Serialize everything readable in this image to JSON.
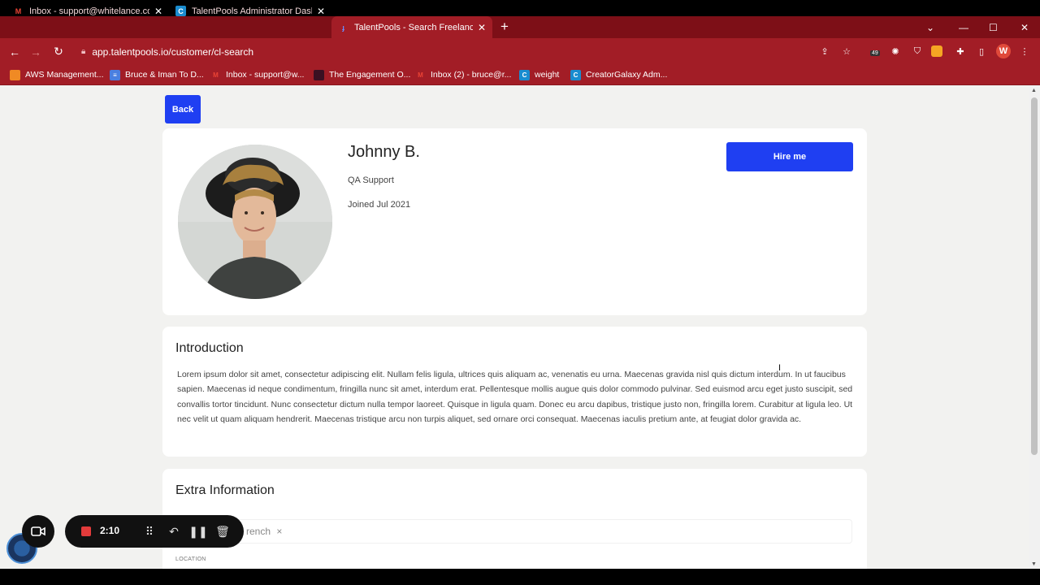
{
  "browser": {
    "tabs": [
      {
        "title": "Inbox - support@whitelance.co",
        "icon": "gmail-icon",
        "active": false
      },
      {
        "title": "TalentPools Administrator Dashb",
        "icon": "talentpools-c-icon",
        "active": false
      },
      {
        "title": "TalentPools - Search Freelancers",
        "icon": "talentpools-f-icon",
        "active": true
      }
    ],
    "url": "app.talentpools.io/customer/cl-search",
    "extension_badge": "49",
    "profile_initial": "W",
    "bookmarks": [
      {
        "label": "AWS Management...",
        "icon": "aws-icon"
      },
      {
        "label": "Bruce & Iman To D...",
        "icon": "docs-icon"
      },
      {
        "label": "Inbox - support@w...",
        "icon": "gmail-icon"
      },
      {
        "label": "The Engagement O...",
        "icon": "engagement-icon"
      },
      {
        "label": "Inbox (2) - bruce@r...",
        "icon": "gmail-icon"
      },
      {
        "label": "weight",
        "icon": "talentpools-c-icon"
      },
      {
        "label": "CreatorGalaxy Adm...",
        "icon": "talentpools-c-icon"
      }
    ]
  },
  "page": {
    "back_label": "Back",
    "profile": {
      "name": "Johnny B.",
      "role": "QA Support",
      "joined": "Joined Jul 2021",
      "hire_label": "Hire me"
    },
    "introduction": {
      "title": "Introduction",
      "text": "Lorem ipsum dolor sit amet, consectetur adipiscing elit. Nullam felis ligula, ultrices quis aliquam ac, venenatis eu urna. Maecenas gravida nisl quis dictum interdum. In ut faucibus sapien. Maecenas id neque condimentum, fringilla nunc sit amet, interdum erat. Pellentesque mollis augue quis dolor commodo pulvinar. Sed euismod arcu eget justo suscipit, sed convallis tortor tincidunt. Nunc consectetur dictum nulla tempor laoreet. Quisque in ligula quam. Donec eu arcu dapibus, tristique justo non, fringilla lorem. Curabitur at ligula leo. Ut nec velit ut quam aliquam hendrerit. Maecenas tristique arcu non turpis aliquet, sed ornare orci consequat. Maecenas iaculis pretium ante, at feugiat dolor gravida ac."
    },
    "extra": {
      "title": "Extra Information",
      "language_chip": "rench",
      "location_label": "LOCATION"
    }
  },
  "recorder": {
    "time": "2:10"
  },
  "colors": {
    "chrome_dark": "#7d0f17",
    "chrome": "#a21d26",
    "primary_button": "#1f3ff2",
    "page_bg": "#f2f2f0"
  }
}
